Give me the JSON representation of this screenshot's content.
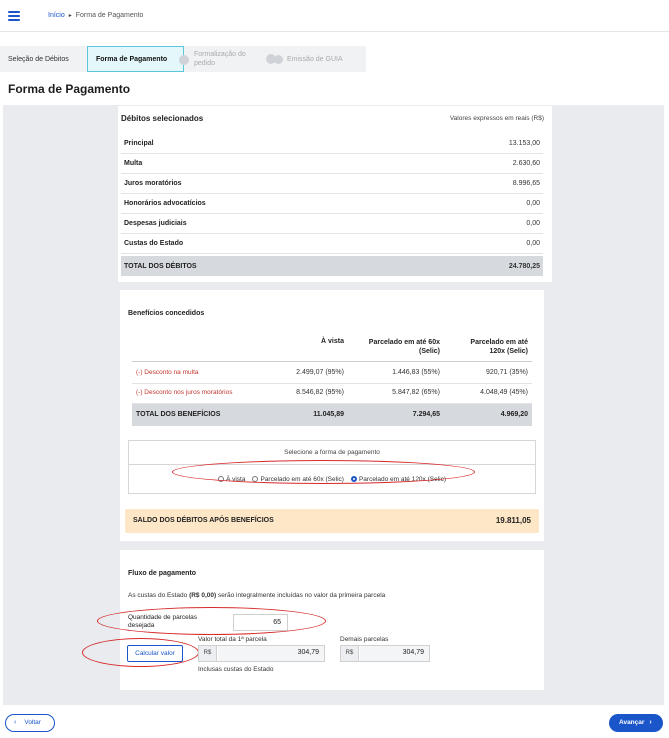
{
  "breadcrumb": {
    "home": "Início",
    "current": "Forma de Pagamento"
  },
  "steps": [
    {
      "label": "Seleção de Débitos"
    },
    {
      "label": "Forma de Pagamento"
    },
    {
      "label_line1": "Formalização do",
      "label_line2": "pedido"
    },
    {
      "label": "Emissão de GUIA"
    }
  ],
  "page_title": "Forma de Pagamento",
  "debitos": {
    "title": "Débitos selecionados",
    "note": "Valores expressos em reais (R$)",
    "rows": [
      {
        "label": "Principal",
        "value": "13.153,00"
      },
      {
        "label": "Multa",
        "value": "2.630,60"
      },
      {
        "label": "Juros moratórios",
        "value": "8.996,65"
      },
      {
        "label": "Honorários advocatícios",
        "value": "0,00"
      },
      {
        "label": "Despesas judiciais",
        "value": "0,00"
      },
      {
        "label": "Custas do Estado",
        "value": "0,00"
      }
    ],
    "total_label": "TOTAL DOS DÉBITOS",
    "total_value": "24.780,25"
  },
  "beneficios": {
    "title": "Benefícios concedidos",
    "headers": {
      "avista": "À vista",
      "p60_l1": "Parcelado em até 60x",
      "p60_l2": "(Selic)",
      "p120_l1": "Parcelado em até",
      "p120_l2": "120x (Selic)"
    },
    "rows": [
      {
        "label": "(-) Desconto na multa",
        "avista": "2.499,07 (95%)",
        "p60": "1.446,83 (55%)",
        "p120": "920,71 (35%)"
      },
      {
        "label": "(-) Desconto nos juros moratórios",
        "avista": "8.546,82 (95%)",
        "p60": "5.847,82 (65%)",
        "p120": "4.048,49 (45%)"
      }
    ],
    "total": {
      "label": "TOTAL DOS BENEFÍCIOS",
      "avista": "11.045,89",
      "p60": "7.294,65",
      "p120": "4.969,20"
    }
  },
  "payment_select": {
    "title": "Selecione a forma de pagamento",
    "options": [
      "À vista",
      "Parcelado em até 60x (Selic)",
      "Parcelado em até 120x (Selic)"
    ],
    "selected": "Parcelado em até 120x (Selic)"
  },
  "saldo": {
    "label": "SALDO DOS DÉBITOS APÓS BENEFÍCIOS",
    "value": "19.811,05"
  },
  "fluxo": {
    "title": "Fluxo de pagamento",
    "note_pre": "As custas do Estado ",
    "note_bold": "(R$ 0,00)",
    "note_post": " serão integralmente incluídas no valor da primeira parcela",
    "qty_label": "Quantidade de parcelas desejada",
    "qty_value": "65",
    "calc_button": "Calcular valor",
    "first_label": "Valor total da 1ª parcela",
    "currency": "R$",
    "first_value": "304,79",
    "first_note": "Inclusas custas do Estado",
    "other_label": "Demais parcelas",
    "other_value": "304,79"
  },
  "nav": {
    "back": "Voltar",
    "next": "Avançar"
  },
  "colors": {
    "primary": "#1a56c9",
    "accent": "#5cc7dc",
    "annotation": "#d62a2a",
    "saldo_bg": "#fde7c7"
  }
}
